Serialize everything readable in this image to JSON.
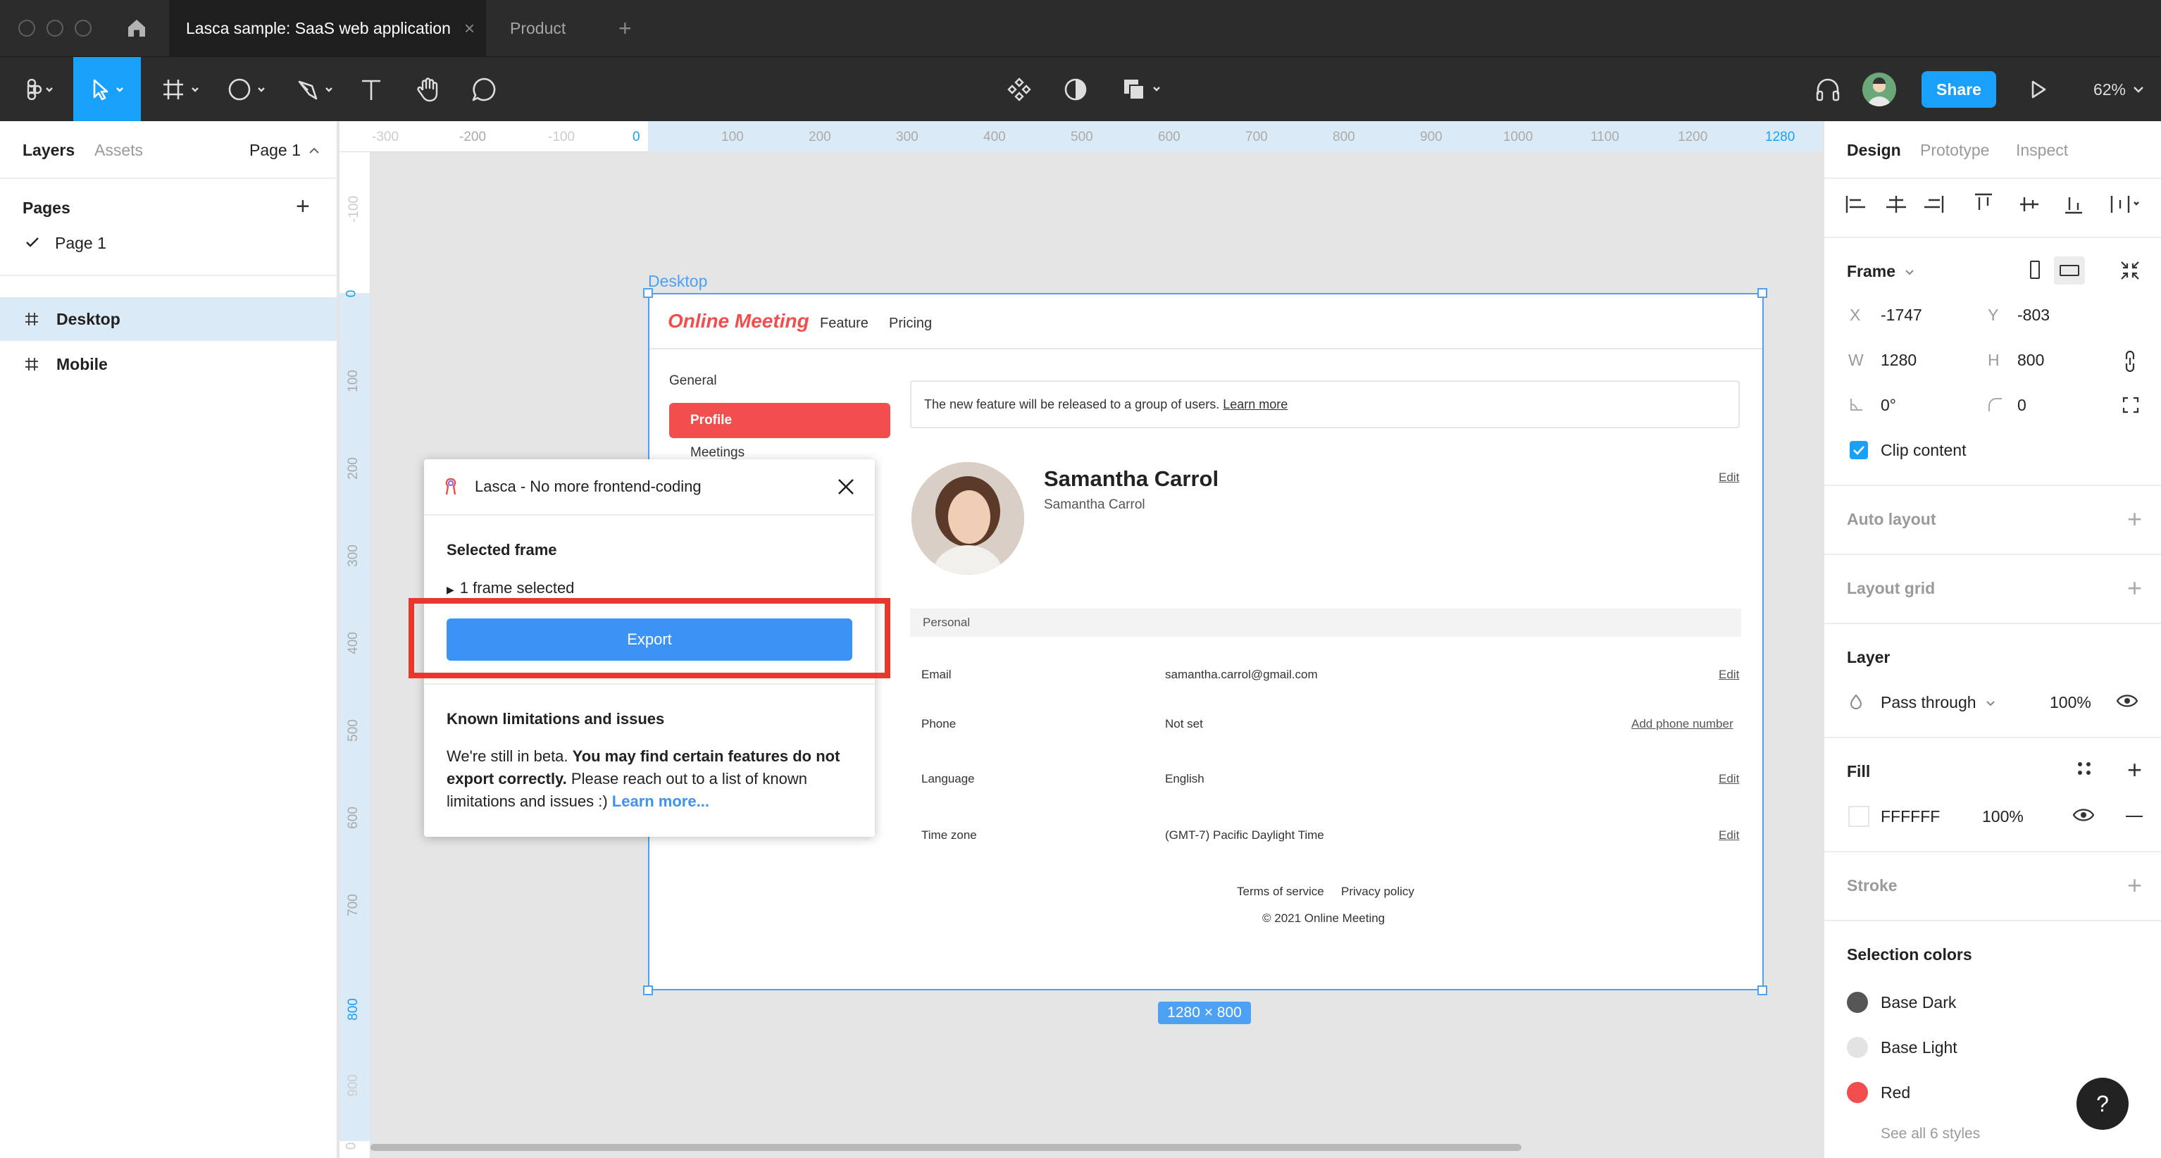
{
  "window": {
    "tabs": [
      {
        "label": "Lasca sample: SaaS web application"
      },
      {
        "label": "Product"
      }
    ]
  },
  "toolbar": {
    "share_label": "Share",
    "zoom": "62%"
  },
  "left_panel": {
    "tabs": {
      "layers": "Layers",
      "assets": "Assets"
    },
    "page_selector": "Page 1",
    "pages_heading": "Pages",
    "pages": [
      {
        "label": "Page 1"
      }
    ],
    "layers": [
      {
        "label": "Desktop"
      },
      {
        "label": "Mobile"
      }
    ]
  },
  "rulers": {
    "h_ticks": [
      "-300",
      "-200",
      "-100",
      "0",
      "100",
      "200",
      "300",
      "400",
      "500",
      "600",
      "700",
      "800",
      "900",
      "1000",
      "1100",
      "1200",
      "1280"
    ],
    "v_ticks": [
      "-100",
      "0",
      "100",
      "200",
      "300",
      "400",
      "500",
      "600",
      "700",
      "800",
      "900",
      "0"
    ]
  },
  "frame": {
    "name": "Desktop",
    "size_badge": "1280 × 800",
    "app": {
      "logo": "Online Meeting",
      "nav": [
        "Feature",
        "Pricing"
      ],
      "sidebar": {
        "section": "General",
        "active": "Profile",
        "next": "Meetings"
      },
      "banner": {
        "text": "The new feature will be released to a group of users.",
        "link": "Learn more"
      },
      "profile": {
        "name": "Samantha Carrol",
        "sub": "Samantha Carrol",
        "edit": "Edit"
      },
      "section_label": "Personal",
      "rows": [
        {
          "label": "Email",
          "value": "samantha.carrol@gmail.com",
          "action": "Edit"
        },
        {
          "label": "Phone",
          "value": "Not set",
          "action": "Add phone number"
        },
        {
          "label": "Language",
          "value": "English",
          "action": "Edit"
        },
        {
          "label": "Time zone",
          "value": "(GMT-7) Pacific Daylight Time",
          "action": "Edit"
        }
      ],
      "footer": {
        "terms": "Terms of service",
        "privacy": "Privacy policy",
        "copyright": "© 2021 Online Meeting"
      }
    }
  },
  "plugin": {
    "title": "Lasca - No more frontend-coding",
    "selected_heading": "Selected frame",
    "selected_text": "1 frame selected",
    "export_label": "Export",
    "limits_heading": "Known limitations and issues",
    "limits_text_1": "We're still in beta.",
    "limits_bold": "You may find certain features do not export correctly.",
    "limits_text_2": "Please reach out to a list of known limitations and issues :)",
    "learn_more": "Learn more...",
    "highlight_color": "#e8382a"
  },
  "right_panel": {
    "tabs": {
      "design": "Design",
      "prototype": "Prototype",
      "inspect": "Inspect"
    },
    "frame_label": "Frame",
    "x_label": "X",
    "x": "-1747",
    "y_label": "Y",
    "y": "-803",
    "w_label": "W",
    "w": "1280",
    "h_label": "H",
    "h": "800",
    "rotation": "0°",
    "radius": "0",
    "clip_content": "Clip content",
    "auto_layout": "Auto layout",
    "layout_grid": "Layout grid",
    "layer_heading": "Layer",
    "blend": "Pass through",
    "layer_opacity": "100%",
    "fill_heading": "Fill",
    "fill_hex": "FFFFFF",
    "fill_opacity": "100%",
    "stroke_heading": "Stroke",
    "selection_colors_heading": "Selection colors",
    "colors": [
      {
        "name": "Base Dark",
        "hex": "#555555"
      },
      {
        "name": "Base Light",
        "hex": "#e3e3e3"
      },
      {
        "name": "Red",
        "hex": "#f24e4e"
      }
    ],
    "see_all": "See all 6 styles",
    "help": "?"
  },
  "colors": {
    "accent": "#18a0fb",
    "brand_red": "#f24e4e",
    "selection_blue": "#4da1f5"
  }
}
